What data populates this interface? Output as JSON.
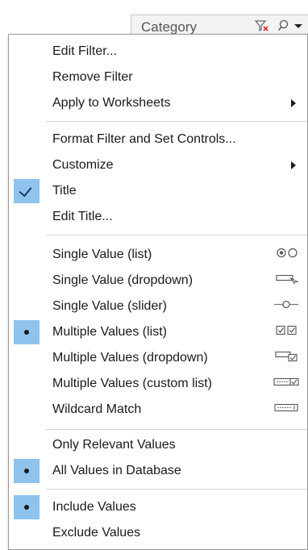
{
  "filter_card": {
    "title": "Category",
    "clear_icon": "clear-filter-icon",
    "search_icon": "search-icon",
    "menu_icon": "dropdown-arrow-icon"
  },
  "menu": {
    "group1": [
      "Edit Filter...",
      "Remove Filter",
      "Apply to Worksheets"
    ],
    "group2": [
      "Format Filter and Set Controls...",
      "Customize",
      "Title",
      "Edit Title..."
    ],
    "group3": [
      "Single Value (list)",
      "Single Value (dropdown)",
      "Single Value (slider)",
      "Multiple Values (list)",
      "Multiple Values (dropdown)",
      "Multiple Values (custom list)",
      "Wildcard Match"
    ],
    "group4": [
      "Only Relevant Values",
      "All Values in Database"
    ],
    "group5": [
      "Include Values",
      "Exclude Values"
    ],
    "checked": [
      "Title"
    ],
    "selected": [
      "Multiple Values (list)",
      "All Values in Database",
      "Include Values"
    ],
    "submenus": [
      "Apply to Worksheets",
      "Customize"
    ]
  },
  "colors": {
    "selection_highlight": "#8ec3ee",
    "border": "#9a9a9a"
  }
}
